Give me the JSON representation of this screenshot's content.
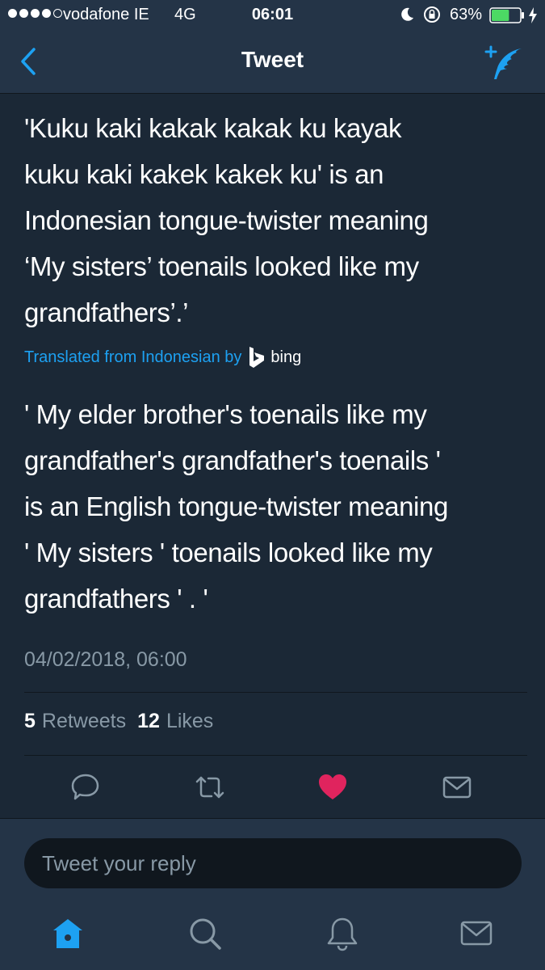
{
  "status_bar": {
    "carrier": "vodafone IE",
    "network": "4G",
    "time": "06:01",
    "battery": "63%",
    "battery_level": 0.63
  },
  "nav": {
    "title": "Tweet",
    "back_icon": "chevron-left-icon",
    "compose_icon": "compose-tweet-icon"
  },
  "tweet": {
    "text": "'Kuku kaki kakak kakak ku kayak\nkuku kaki kakek kakek ku' is an\nIndonesian tongue-twister meaning\n‘My sisters’ toenails looked like my\ngrandfathers’.’",
    "translated_label": "Translated from Indonesian by",
    "translator": "bing",
    "translation": "' My elder brother's toenails like my\ngrandfather's grandfather's toenails '\nis an English tongue-twister meaning\n' My sisters ' toenails looked like my\ngrandfathers ' . '",
    "timestamp": "04/02/2018, 06:00"
  },
  "stats": {
    "retweets_count": "5",
    "retweets_label": "Retweets",
    "likes_count": "12",
    "likes_label": "Likes"
  },
  "actions": [
    {
      "name": "reply",
      "icon": "reply-icon"
    },
    {
      "name": "retweet",
      "icon": "retweet-icon"
    },
    {
      "name": "like",
      "icon": "heart-icon",
      "active": true
    },
    {
      "name": "message",
      "icon": "mail-icon"
    }
  ],
  "reply": {
    "placeholder": "Tweet your reply"
  },
  "tab_bar": [
    {
      "name": "home",
      "icon": "home-icon",
      "active": true
    },
    {
      "name": "search",
      "icon": "search-icon"
    },
    {
      "name": "notifications",
      "icon": "bell-icon"
    },
    {
      "name": "messages",
      "icon": "mail-icon"
    }
  ],
  "colors": {
    "background": "#1b2836",
    "bar": "#243447",
    "accent": "#1da1f2",
    "like": "#e0245e",
    "muted": "#8899a6"
  }
}
